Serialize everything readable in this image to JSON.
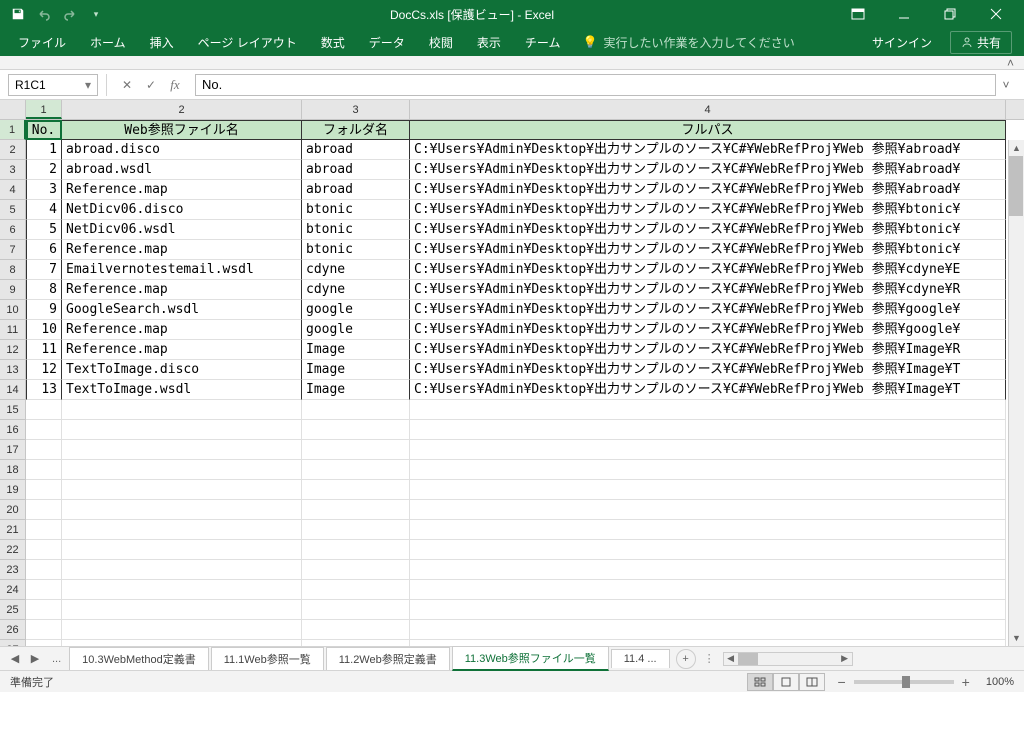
{
  "app": {
    "title": "DocCs.xls  [保護ビュー] - Excel"
  },
  "qat": {
    "save": "save-icon",
    "undo": "undo-icon",
    "redo": "redo-icon"
  },
  "window": {
    "ribbon_opts": "ribbon-options-icon",
    "minimize": "minimize-icon",
    "restore": "restore-icon",
    "close": "close-icon"
  },
  "ribbon": {
    "tabs": [
      "ファイル",
      "ホーム",
      "挿入",
      "ページ レイアウト",
      "数式",
      "データ",
      "校閲",
      "表示",
      "チーム"
    ],
    "tell_me": "実行したい作業を入力してください",
    "signin": "サインイン",
    "share": "共有"
  },
  "formula_bar": {
    "namebox": "R1C1",
    "value": "No."
  },
  "columns": [
    "1",
    "2",
    "3",
    "4"
  ],
  "headers": {
    "c1": "No.",
    "c2": "Web参照ファイル名",
    "c3": "フォルダ名",
    "c4": "フルパス"
  },
  "rows": [
    {
      "n": "1",
      "f": "abroad.disco",
      "d": "abroad",
      "p": "C:\\Users\\Admin\\Desktop\\出力サンプルのソース\\C#\\WebRefProj\\Web 参照\\abroad\\"
    },
    {
      "n": "2",
      "f": "abroad.wsdl",
      "d": "abroad",
      "p": "C:\\Users\\Admin\\Desktop\\出力サンプルのソース\\C#\\WebRefProj\\Web 参照\\abroad\\"
    },
    {
      "n": "3",
      "f": "Reference.map",
      "d": "abroad",
      "p": "C:\\Users\\Admin\\Desktop\\出力サンプルのソース\\C#\\WebRefProj\\Web 参照\\abroad\\"
    },
    {
      "n": "4",
      "f": "NetDicv06.disco",
      "d": "btonic",
      "p": "C:\\Users\\Admin\\Desktop\\出力サンプルのソース\\C#\\WebRefProj\\Web 参照\\btonic\\"
    },
    {
      "n": "5",
      "f": "NetDicv06.wsdl",
      "d": "btonic",
      "p": "C:\\Users\\Admin\\Desktop\\出力サンプルのソース\\C#\\WebRefProj\\Web 参照\\btonic\\"
    },
    {
      "n": "6",
      "f": "Reference.map",
      "d": "btonic",
      "p": "C:\\Users\\Admin\\Desktop\\出力サンプルのソース\\C#\\WebRefProj\\Web 参照\\btonic\\"
    },
    {
      "n": "7",
      "f": "Emailvernotestemail.wsdl",
      "d": "cdyne",
      "p": "C:\\Users\\Admin\\Desktop\\出力サンプルのソース\\C#\\WebRefProj\\Web 参照\\cdyne\\E"
    },
    {
      "n": "8",
      "f": "Reference.map",
      "d": "cdyne",
      "p": "C:\\Users\\Admin\\Desktop\\出力サンプルのソース\\C#\\WebRefProj\\Web 参照\\cdyne\\R"
    },
    {
      "n": "9",
      "f": "GoogleSearch.wsdl",
      "d": "google",
      "p": "C:\\Users\\Admin\\Desktop\\出力サンプルのソース\\C#\\WebRefProj\\Web 参照\\google\\"
    },
    {
      "n": "10",
      "f": "Reference.map",
      "d": "google",
      "p": "C:\\Users\\Admin\\Desktop\\出力サンプルのソース\\C#\\WebRefProj\\Web 参照\\google\\"
    },
    {
      "n": "11",
      "f": "Reference.map",
      "d": "Image",
      "p": "C:\\Users\\Admin\\Desktop\\出力サンプルのソース\\C#\\WebRefProj\\Web 参照\\Image\\R"
    },
    {
      "n": "12",
      "f": "TextToImage.disco",
      "d": "Image",
      "p": "C:\\Users\\Admin\\Desktop\\出力サンプルのソース\\C#\\WebRefProj\\Web 参照\\Image\\T"
    },
    {
      "n": "13",
      "f": "TextToImage.wsdl",
      "d": "Image",
      "p": "C:\\Users\\Admin\\Desktop\\出力サンプルのソース\\C#\\WebRefProj\\Web 参照\\Image\\T"
    }
  ],
  "empty_rows_start": 15,
  "empty_rows_end": 27,
  "sheet_tabs": {
    "ellipsis_left": "...",
    "tabs": [
      "10.3WebMethod定義書",
      "11.1Web参照一覧",
      "11.2Web参照定義書",
      "11.3Web参照ファイル一覧"
    ],
    "active_index": 3,
    "next_partial": "11.4 ...",
    "ellipsis_right": "..."
  },
  "status": {
    "ready": "準備完了",
    "zoom": "100%"
  }
}
